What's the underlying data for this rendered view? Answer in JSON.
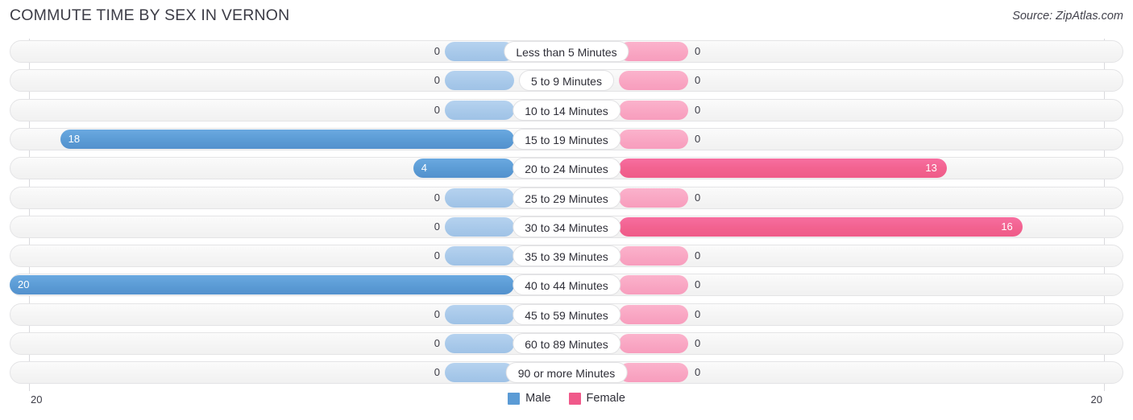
{
  "header": {
    "title": "COMMUTE TIME BY SEX IN VERNON",
    "source": "Source: ZipAtlas.com"
  },
  "axis": {
    "left_label": "20",
    "right_label": "20"
  },
  "legend": {
    "items": [
      {
        "label": "Male",
        "color": "#5b9bd5"
      },
      {
        "label": "Female",
        "color": "#f0598a"
      }
    ]
  },
  "chart_data": {
    "type": "bar",
    "title": "COMMUTE TIME BY SEX IN VERNON",
    "subtitle": "Source: ZipAtlas.com",
    "orientation": "horizontal-diverging",
    "xlabel": "",
    "ylabel": "",
    "xlim": [
      20,
      20
    ],
    "axis_max": 20,
    "grid": true,
    "legend_position": "bottom-center",
    "categories": [
      "Less than 5 Minutes",
      "5 to 9 Minutes",
      "10 to 14 Minutes",
      "15 to 19 Minutes",
      "20 to 24 Minutes",
      "25 to 29 Minutes",
      "30 to 34 Minutes",
      "35 to 39 Minutes",
      "40 to 44 Minutes",
      "45 to 59 Minutes",
      "60 to 89 Minutes",
      "90 or more Minutes"
    ],
    "series": [
      {
        "name": "Male",
        "color": "#5b9bd5",
        "side": "left",
        "values": [
          0,
          0,
          0,
          18,
          4,
          0,
          0,
          0,
          20,
          0,
          0,
          0
        ],
        "labels": [
          "0",
          "0",
          "0",
          "18",
          "4",
          "0",
          "0",
          "0",
          "20",
          "0",
          "0",
          "0"
        ]
      },
      {
        "name": "Female",
        "color": "#f0598a",
        "side": "right",
        "values": [
          0,
          0,
          0,
          0,
          13,
          0,
          16,
          0,
          0,
          0,
          0,
          0
        ],
        "labels": [
          "0",
          "0",
          "0",
          "0",
          "13",
          "0",
          "16",
          "0",
          "0",
          "0",
          "0",
          "0"
        ]
      }
    ]
  }
}
